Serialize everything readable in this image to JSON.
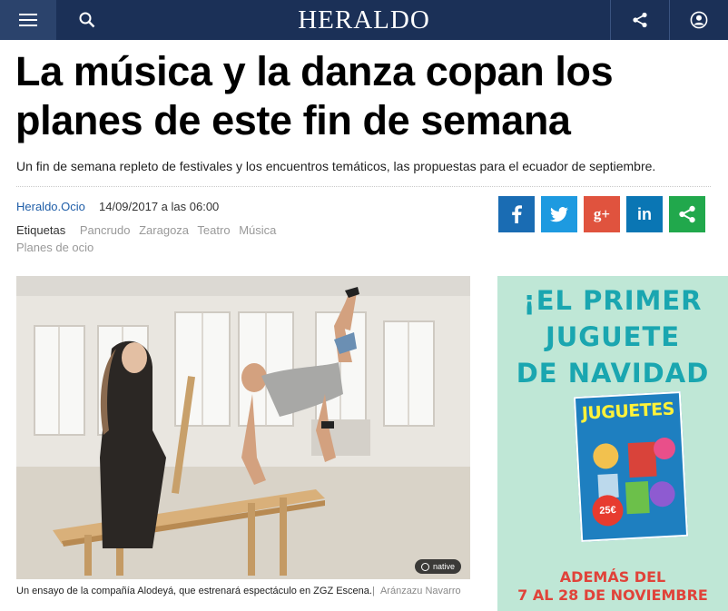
{
  "header": {
    "logo": "HERALDO",
    "menu_icon": "hamburger-icon",
    "search_icon": "search-icon",
    "share_icon": "share-icon",
    "user_icon": "user-icon"
  },
  "article": {
    "headline": "La música y la danza copan los planes de este fin de semana",
    "subtitle": "Un fin de semana repleto de festivales y los encuentros temáticos, las propuestas para el ecuador de septiembre.",
    "section": "Heraldo.Ocio",
    "date": "14/09/2017 a las 06:00",
    "tags_label": "Etiquetas",
    "tags": [
      "Pancrudo",
      "Zaragoza",
      "Teatro",
      "Música",
      "Planes de ocio"
    ]
  },
  "share_buttons": [
    {
      "icon": "facebook-icon",
      "glyph": "f",
      "color": "#1a6cb3"
    },
    {
      "icon": "twitter-icon",
      "glyph": "t",
      "color": "#1e9ae0"
    },
    {
      "icon": "google-plus-icon",
      "glyph": "g+",
      "color": "#e0533e"
    },
    {
      "icon": "linkedin-icon",
      "glyph": "in",
      "color": "#0a76b4"
    },
    {
      "icon": "share-icon",
      "glyph": "<",
      "color": "#21a84c"
    }
  ],
  "photo": {
    "badge": "native",
    "caption": "Un ensayo de la compañía Alodeyá, que estrenará espectáculo en ZGZ Escena.",
    "separator": "|",
    "credit": "Aránzazu Navarro"
  },
  "ad": {
    "line1": "¡EL PRIMER",
    "line2": "JUGUETE",
    "line3": "DE NAVIDAD",
    "catalog_title": "JUGUETES",
    "catalog_badge": "25€",
    "bottom1": "ADEMÁS DEL",
    "bottom2": "7 AL 28 DE NOVIEMBRE"
  },
  "colors": {
    "topbar": "#1b3057",
    "link": "#1f5ea8",
    "ad_background": "#bfe7d6",
    "ad_text": "#1aa6b0",
    "ad_accent": "#e0433a"
  }
}
